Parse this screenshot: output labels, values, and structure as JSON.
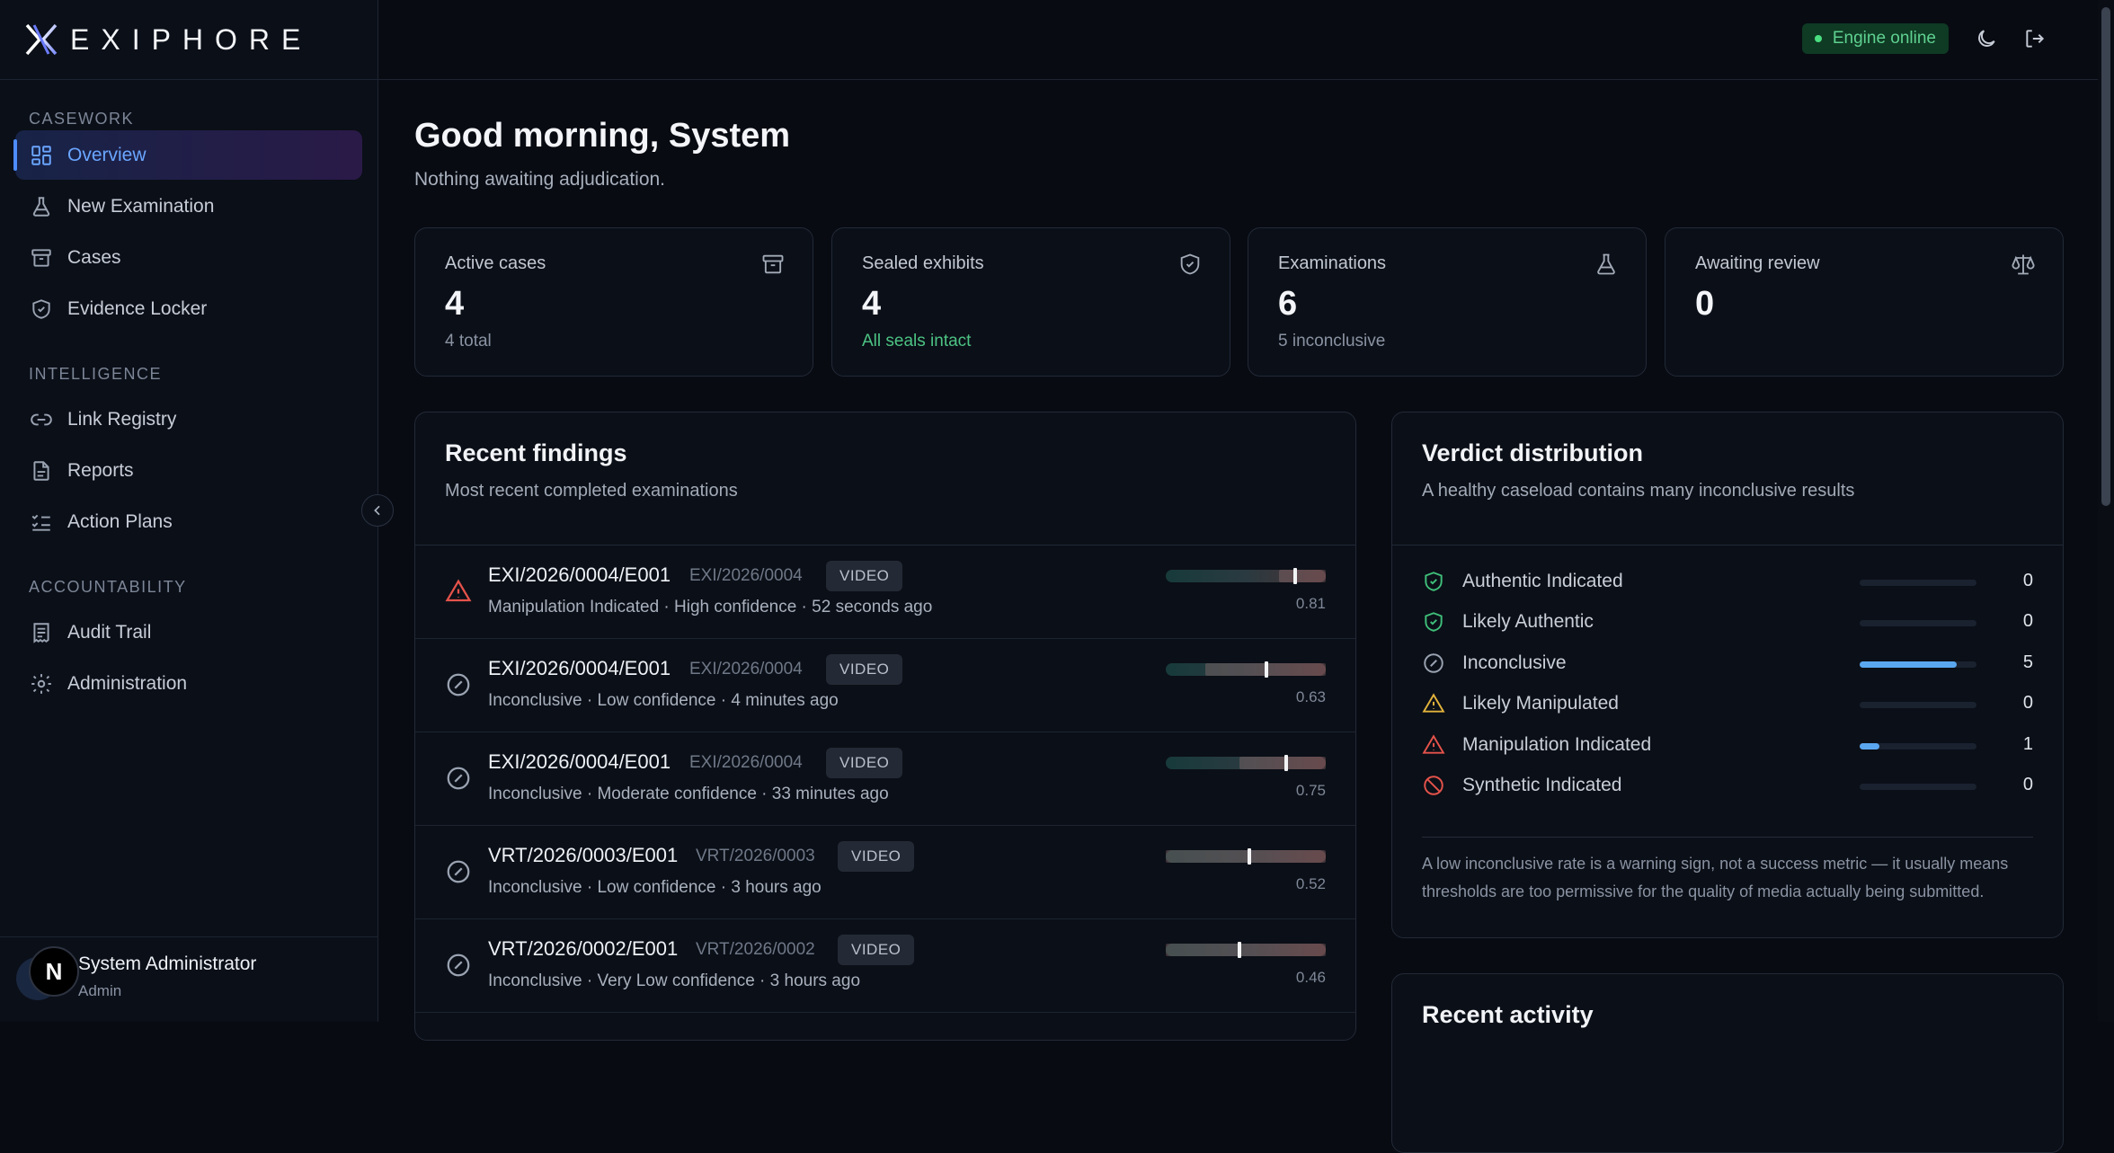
{
  "brand": {
    "name": "EXIPHORE"
  },
  "sidebar": {
    "sections": [
      {
        "title": "CASEWORK",
        "items": [
          {
            "label": "Overview",
            "icon": "grid-icon",
            "active": true
          },
          {
            "label": "New Examination",
            "icon": "flask-icon"
          },
          {
            "label": "Cases",
            "icon": "archive-icon"
          },
          {
            "label": "Evidence Locker",
            "icon": "shield-icon"
          }
        ]
      },
      {
        "title": "INTELLIGENCE",
        "items": [
          {
            "label": "Link Registry",
            "icon": "link-icon"
          },
          {
            "label": "Reports",
            "icon": "document-icon"
          },
          {
            "label": "Action Plans",
            "icon": "checklist-icon"
          }
        ]
      },
      {
        "title": "ACCOUNTABILITY",
        "items": [
          {
            "label": "Audit Trail",
            "icon": "receipt-icon"
          },
          {
            "label": "Administration",
            "icon": "gear-icon"
          }
        ]
      }
    ],
    "user": {
      "name": "System Administrator",
      "role": "Admin",
      "badge": "N"
    }
  },
  "topbar": {
    "engine_status": "Engine online"
  },
  "main": {
    "greeting": "Good morning, System",
    "subtitle": "Nothing awaiting adjudication."
  },
  "stats": [
    {
      "label": "Active cases",
      "value": "4",
      "sub": "4 total",
      "icon": "archive-icon"
    },
    {
      "label": "Sealed exhibits",
      "value": "4",
      "sub": "All seals intact",
      "sub_color": "#4cc384",
      "icon": "shield-icon"
    },
    {
      "label": "Examinations",
      "value": "6",
      "sub": "5 inconclusive",
      "icon": "flask-icon"
    },
    {
      "label": "Awaiting review",
      "value": "0",
      "sub": "",
      "icon": "scale-icon"
    }
  ],
  "findings": {
    "title": "Recent findings",
    "subtitle": "Most recent completed examinations",
    "rows": [
      {
        "id": "EXI/2026/0004/E001",
        "case": "EXI/2026/0004",
        "media": "VIDEO",
        "status": "Manipulation Indicated · High confidence · 52 seconds ago",
        "icon": "warning-icon",
        "score": "0.81",
        "marker": 0.81
      },
      {
        "id": "EXI/2026/0004/E001",
        "case": "EXI/2026/0004",
        "media": "VIDEO",
        "status": "Inconclusive · Low confidence · 4 minutes ago",
        "icon": "inconclusive-icon",
        "score": "0.63",
        "marker": 0.63
      },
      {
        "id": "EXI/2026/0004/E001",
        "case": "EXI/2026/0004",
        "media": "VIDEO",
        "status": "Inconclusive · Moderate confidence · 33 minutes ago",
        "icon": "inconclusive-icon",
        "score": "0.75",
        "marker": 0.75
      },
      {
        "id": "VRT/2026/0003/E001",
        "case": "VRT/2026/0003",
        "media": "VIDEO",
        "status": "Inconclusive · Low confidence · 3 hours ago",
        "icon": "inconclusive-icon",
        "score": "0.52",
        "marker": 0.52
      },
      {
        "id": "VRT/2026/0002/E001",
        "case": "VRT/2026/0002",
        "media": "VIDEO",
        "status": "Inconclusive · Very Low confidence · 3 hours ago",
        "icon": "inconclusive-icon",
        "score": "0.46",
        "marker": 0.46
      }
    ]
  },
  "verdicts": {
    "title": "Verdict distribution",
    "subtitle": "A healthy caseload contains many inconclusive results",
    "rows": [
      {
        "label": "Authentic Indicated",
        "count": "0",
        "fraction": 0,
        "icon": "shield-check-icon",
        "color": "#3fbf7a"
      },
      {
        "label": "Likely Authentic",
        "count": "0",
        "fraction": 0,
        "icon": "shield-check-icon",
        "color": "#3fbf7a"
      },
      {
        "label": "Inconclusive",
        "count": "5",
        "fraction": 0.833,
        "icon": "inconclusive-icon",
        "color": "#9aa3b2"
      },
      {
        "label": "Likely Manipulated",
        "count": "0",
        "fraction": 0,
        "icon": "warning-icon",
        "color": "#e2b33c"
      },
      {
        "label": "Manipulation Indicated",
        "count": "1",
        "fraction": 0.167,
        "icon": "warning-icon",
        "color": "#e5534b"
      },
      {
        "label": "Synthetic Indicated",
        "count": "0",
        "fraction": 0,
        "icon": "ban-icon",
        "color": "#e5534b"
      }
    ],
    "note": "A low inconclusive rate is a warning sign, not a success metric — it usually means thresholds are too permissive for the quality of media actually being submitted."
  },
  "activity": {
    "title": "Recent activity"
  }
}
